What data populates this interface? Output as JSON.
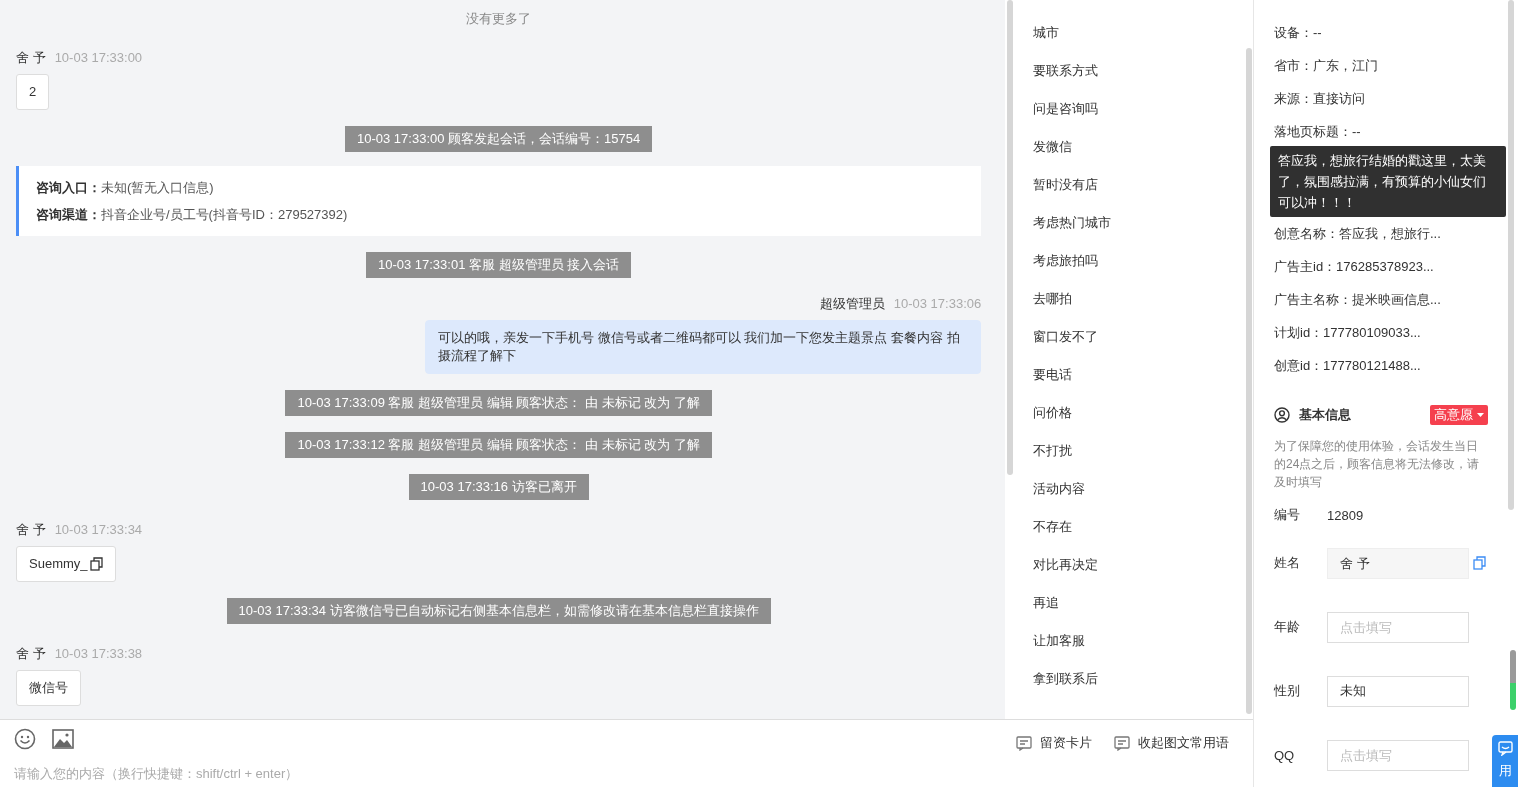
{
  "chat": {
    "messages": [
      {
        "kind": "notice",
        "text": "没有更多了"
      },
      {
        "kind": "customer",
        "name": "舍 予",
        "time": "10-03 17:33:00",
        "text": "2",
        "copyable": false
      },
      {
        "kind": "system",
        "text": "10-03 17:33:00 顾客发起会话，会话编号：15754"
      },
      {
        "kind": "entry",
        "lines": [
          {
            "label": "咨询入口：",
            "value": "未知(暂无入口信息)"
          },
          {
            "label": "咨询渠道：",
            "value": "抖音企业号/员工号(抖音号ID：279527392)"
          }
        ]
      },
      {
        "kind": "system",
        "text": "10-03 17:33:01 客服 超级管理员 接入会话"
      },
      {
        "kind": "agent",
        "name": "超级管理员",
        "time": "10-03 17:33:06",
        "text": "可以的哦，亲发一下手机号 微信号或者二维码都可以 我们加一下您发主题景点 套餐内容 拍摄流程了解下"
      },
      {
        "kind": "system",
        "text": "10-03 17:33:09 客服 超级管理员 编辑 顾客状态： 由 未标记 改为 了解"
      },
      {
        "kind": "system",
        "text": "10-03 17:33:12 客服 超级管理员 编辑 顾客状态： 由 未标记 改为 了解"
      },
      {
        "kind": "system",
        "text": "10-03 17:33:16 访客已离开"
      },
      {
        "kind": "customer",
        "name": "舍 予",
        "time": "10-03 17:33:34",
        "text": "Suemmy_",
        "copyable": true
      },
      {
        "kind": "system",
        "text": "10-03 17:33:34 访客微信号已自动标记右侧基本信息栏，如需修改请在基本信息栏直接操作"
      },
      {
        "kind": "customer",
        "name": "舍 予",
        "time": "10-03 17:33:38",
        "text": "微信号",
        "copyable": false
      }
    ]
  },
  "input": {
    "placeholder": "请输入您的内容（换行快捷键：shift/ctrl + enter）"
  },
  "quick_replies": {
    "items": [
      "城市",
      "要联系方式",
      "问是咨询吗",
      "发微信",
      "暂时没有店",
      "考虑热门城市",
      "考虑旅拍吗",
      "去哪拍",
      "窗口发不了",
      "要电话",
      "问价格",
      "不打扰",
      "活动内容",
      "不存在",
      "对比再决定",
      "再追",
      "让加客服",
      "拿到联系后"
    ],
    "actions": [
      "留资卡片",
      "收起图文常用语"
    ]
  },
  "visitor_info": {
    "lines": [
      "设备：--",
      "省市：广东，江门",
      "来源：直接访问",
      "落地页标题：--",
      "创意名称：答应我，想旅行...",
      "广告主id：176285378923...",
      "广告主名称：提米映画信息...",
      "计划id：177780109033...",
      "创意id：177780121488..."
    ],
    "tooltip": "答应我，想旅行结婚的戳这里，太美了，氛围感拉满，有预算的小仙女们可以冲！！！"
  },
  "basic_info": {
    "title": "基本信息",
    "intent_tag": "高意愿",
    "note": "为了保障您的使用体验，会话发生当日的24点之后，顾客信息将无法修改，请及时填写",
    "fields": [
      {
        "kind": "text",
        "label": "编号",
        "value": "12809"
      },
      {
        "kind": "readonly",
        "label": "姓名",
        "value": "舍 予"
      },
      {
        "kind": "input",
        "label": "年龄",
        "placeholder": "点击填写"
      },
      {
        "kind": "input",
        "label": "性别",
        "value": "未知"
      },
      {
        "kind": "input",
        "label": "QQ",
        "placeholder": "点击填写"
      }
    ]
  },
  "side_button": {
    "label": "用"
  }
}
